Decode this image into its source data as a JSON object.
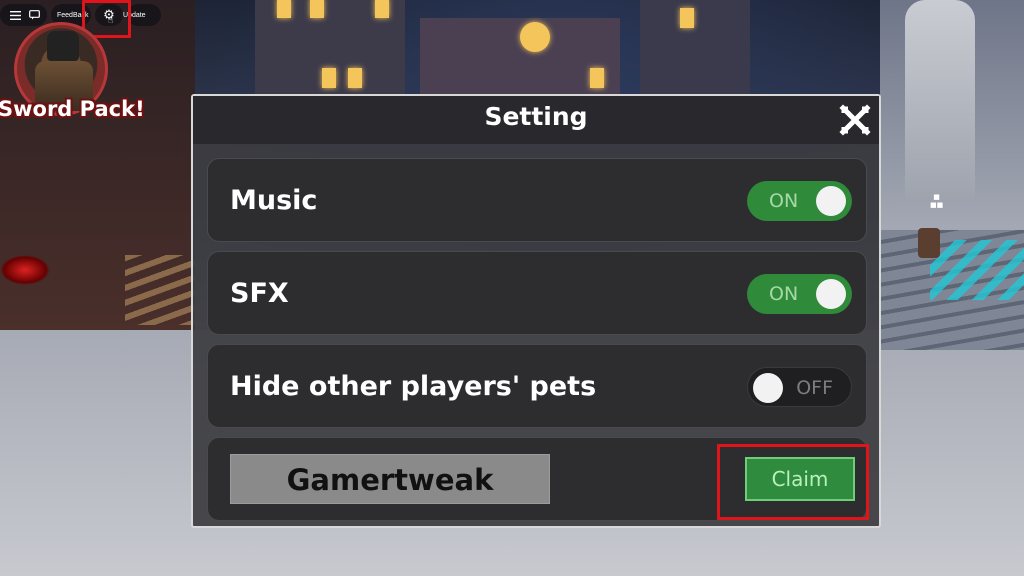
{
  "topbar": {
    "menu_icon": "hamburger-menu-icon",
    "chat_icon": "chat-icon",
    "feedback_label": "FeedBack",
    "settings_icon": "gear-icon",
    "update_label": "Update"
  },
  "pack": {
    "label": "Sword Pack!"
  },
  "dialog": {
    "title": "Setting",
    "close_icon": "close-x-icon",
    "rows": [
      {
        "label": "Music",
        "state": "ON"
      },
      {
        "label": "SFX",
        "state": "ON"
      },
      {
        "label": "Hide other players' pets",
        "state": "OFF"
      }
    ],
    "code_value": "Gamertweak",
    "claim_label": "Claim"
  },
  "colors": {
    "toggle_on": "#2f8a3a",
    "toggle_off": "#1f1f22",
    "highlight": "#e0141b",
    "dialog_bg": "#3c3c40"
  }
}
